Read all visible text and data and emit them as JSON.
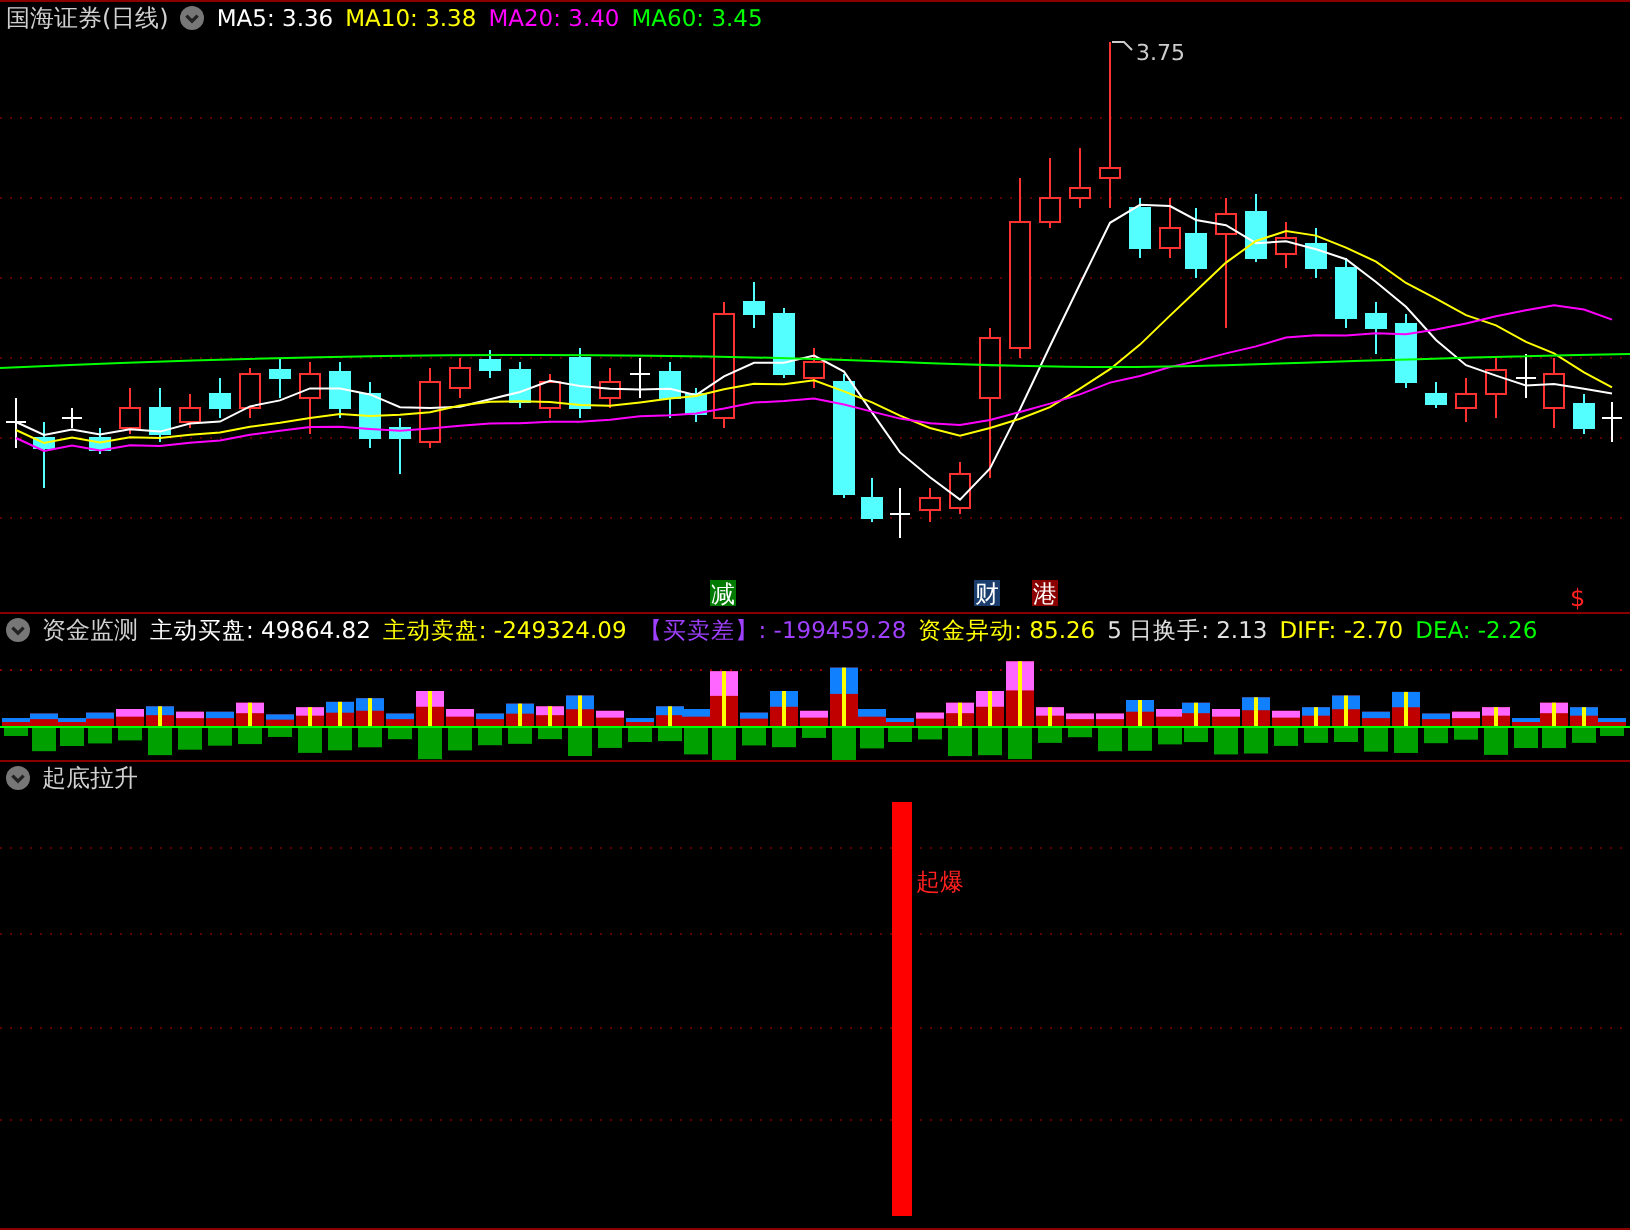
{
  "price_panel": {
    "title": "国海证券(日线)",
    "indicators": [
      {
        "label": "MA5: 3.36",
        "color": "#ffffff"
      },
      {
        "label": "MA10: 3.38",
        "color": "#ffff00"
      },
      {
        "label": "MA20: 3.40",
        "color": "#ff00ff"
      },
      {
        "label": "MA60: 3.45",
        "color": "#00ff00"
      }
    ],
    "high_label": "3.75",
    "event_markers": [
      {
        "text": "减",
        "color": "#007a00"
      },
      {
        "text": "财",
        "color": "#1a3d6e"
      },
      {
        "text": "港",
        "color": "#8a0000"
      }
    ],
    "currency_marker": "$"
  },
  "money_panel": {
    "title": "资金监测",
    "indicators": [
      {
        "label": "主动买盘: 49864.82",
        "color": "#ffffff"
      },
      {
        "label": "主动卖盘: -249324.09",
        "color": "#ffff00"
      },
      {
        "label": "【买卖差】: -199459.28",
        "color": "#a040ff"
      },
      {
        "label": "资金异动: 85.26",
        "color": "#ffff00"
      },
      {
        "label": "5 日换手: 2.13",
        "color": "#e0e0e0"
      },
      {
        "label": "DIFF: -2.70",
        "color": "#ffff00"
      },
      {
        "label": "DEA: -2.26",
        "color": "#00ff00"
      }
    ]
  },
  "signal_panel": {
    "title": "起底拉升",
    "signal_label": "起爆"
  }
}
